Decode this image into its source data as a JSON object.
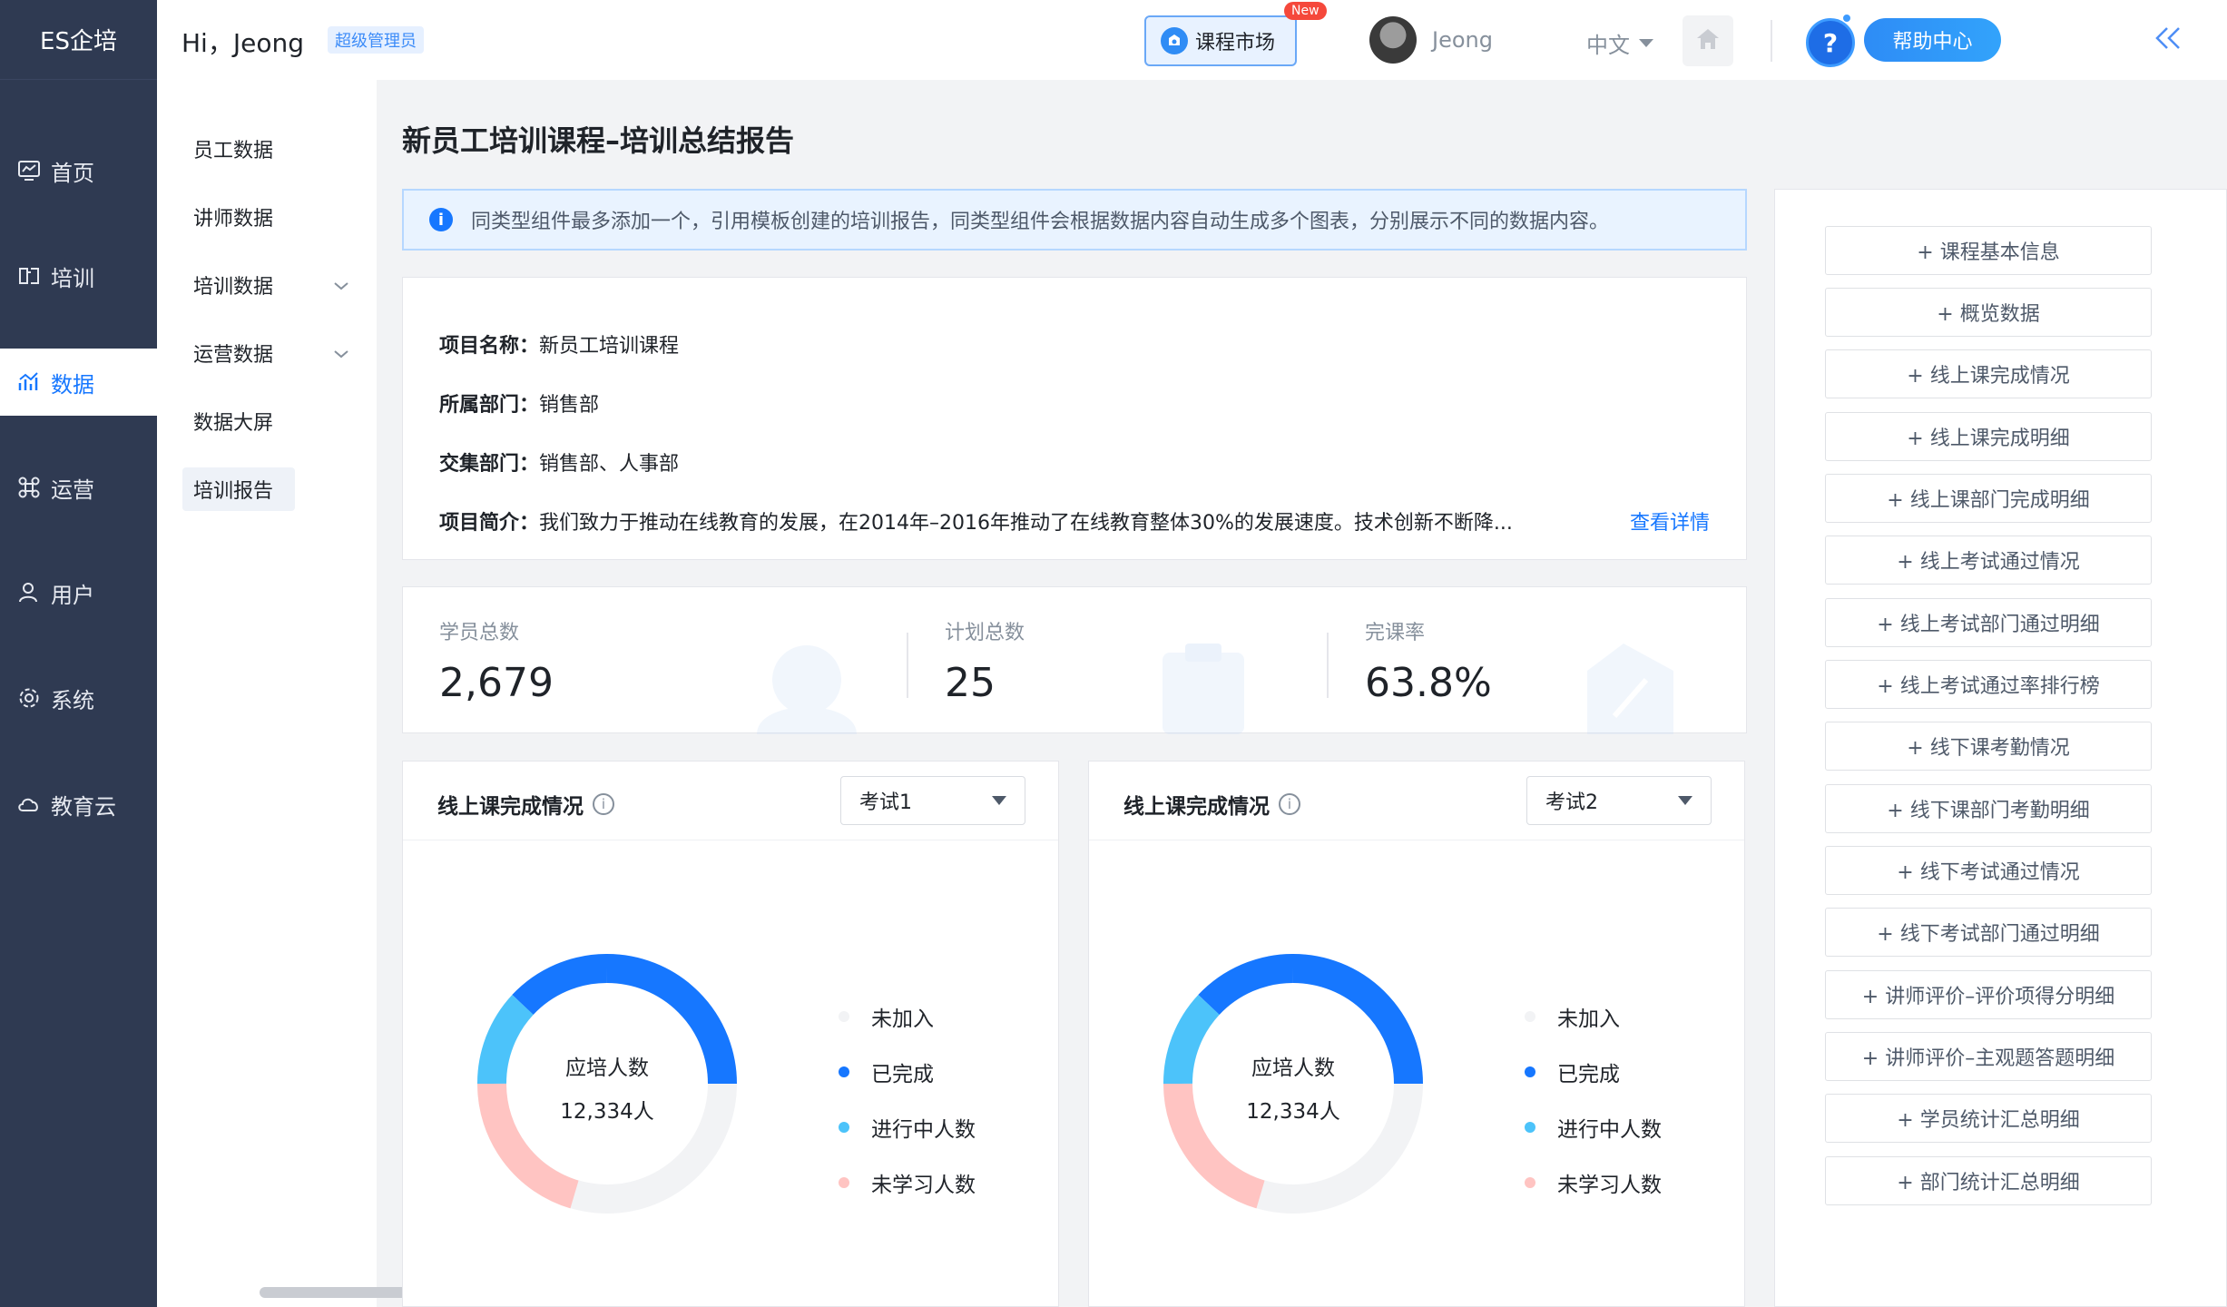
{
  "brand": "ES企培",
  "nav": [
    {
      "label": "首页",
      "icon": "dashboard-icon",
      "active": false
    },
    {
      "label": "培训",
      "icon": "training-icon",
      "active": false
    },
    {
      "label": "数据",
      "icon": "data-chart-icon",
      "active": true
    },
    {
      "label": "运营",
      "icon": "command-icon",
      "active": false
    },
    {
      "label": "用户",
      "icon": "user-icon",
      "active": false
    },
    {
      "label": "系统",
      "icon": "gear-icon",
      "active": false
    },
    {
      "label": "教育云",
      "icon": "cloud-icon",
      "active": false
    }
  ],
  "submenu": [
    {
      "label": "员工数据",
      "expandable": false,
      "active": false
    },
    {
      "label": "讲师数据",
      "expandable": false,
      "active": false
    },
    {
      "label": "培训数据",
      "expandable": true,
      "active": false
    },
    {
      "label": "运营数据",
      "expandable": true,
      "active": false
    },
    {
      "label": "数据大屏",
      "expandable": false,
      "active": false
    },
    {
      "label": "培训报告",
      "expandable": false,
      "active": true
    }
  ],
  "header": {
    "greeting": "Hi，Jeong",
    "role": "超级管理员",
    "market": "课程市场",
    "new_badge": "New",
    "user": "Jeong",
    "language": "中文",
    "help_q": "?",
    "help": "帮助中心"
  },
  "page": {
    "title": "新员工培训课程–培训总结报告",
    "info": "同类型组件最多添加一个，引用模板创建的培训报告，同类型组件会根据数据内容自动生成多个图表，分别展示不同的数据内容。"
  },
  "project": {
    "name_label": "项目名称：",
    "name": "新员工培训课程",
    "dept_label": "所属部门：",
    "dept": "销售部",
    "collect_label": "交集部门：",
    "collect": "销售部、人事部",
    "intro_label": "项目简介：",
    "intro": "我们致力于推动在线教育的发展，在2014年–2016年推动了在线教育整体30%的发展速度。技术创新不断降...",
    "more": "查看详情"
  },
  "stats": [
    {
      "label": "学员总数",
      "value": "2,679"
    },
    {
      "label": "计划总数",
      "value": "25"
    },
    {
      "label": "完课率",
      "value": "63.8%"
    }
  ],
  "charts": [
    {
      "title": "线上课完成情况",
      "select": "考试1",
      "center_label": "应培人数",
      "center_value": "12,334人",
      "legend": [
        "未加入",
        "已完成",
        "进行中人数",
        "未学习人数"
      ]
    },
    {
      "title": "线上课完成情况",
      "select": "考试2",
      "center_label": "应培人数",
      "center_value": "12,334人",
      "legend": [
        "未加入",
        "已完成",
        "进行中人数",
        "未学习人数"
      ]
    }
  ],
  "colors": {
    "not_joined": "#f2f3f5",
    "completed": "#1677ff",
    "in_progress": "#4cc3fa",
    "not_studied": "#ffc4c2"
  },
  "components": [
    "+ 课程基本信息",
    "+ 概览数据",
    "+ 线上课完成情况",
    "+ 线上课完成明细",
    "+ 线上课部门完成明细",
    "+ 线上考试通过情况",
    "+ 线上考试部门通过明细",
    "+ 线上考试通过率排行榜",
    "+ 线下课考勤情况",
    "+ 线下课部门考勤明细",
    "+ 线下考试通过情况",
    "+ 线下考试部门通过明细",
    "+ 讲师评价–评价项得分明细",
    "+ 讲师评价–主观题答题明细",
    "+ 学员统计汇总明细",
    "+ 部门统计汇总明细"
  ]
}
